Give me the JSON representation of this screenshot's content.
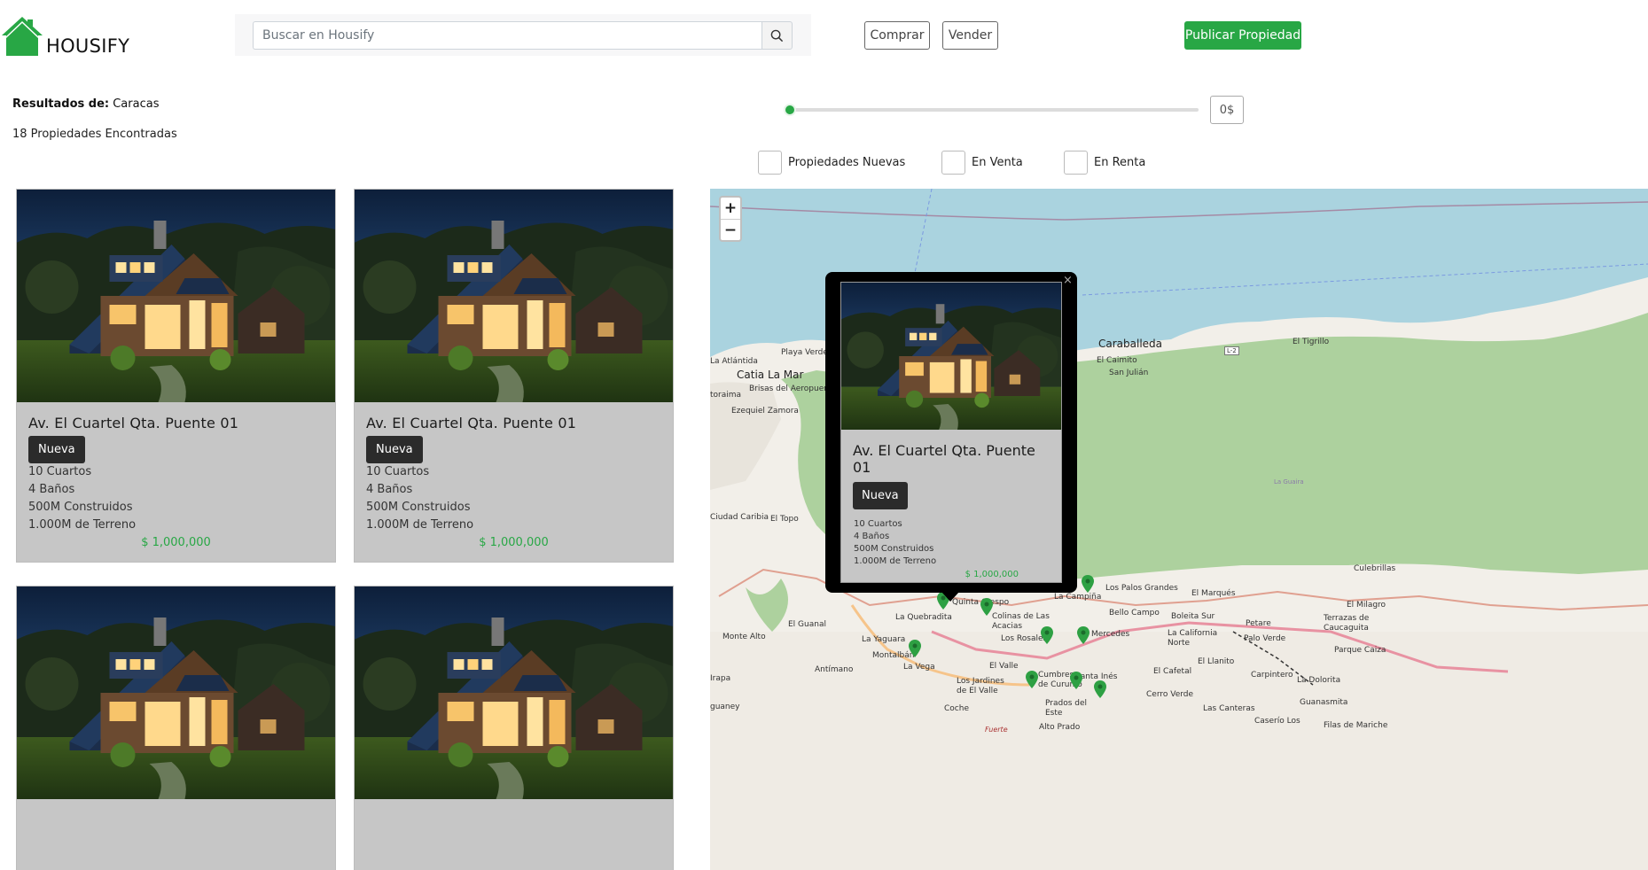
{
  "header": {
    "brand": "HOUSIFY",
    "search_placeholder": "Buscar en Housify",
    "buy_label": "Comprar",
    "sell_label": "Vender",
    "publish_label": "Publicar Propiedad"
  },
  "results": {
    "label": "Resultados de:",
    "location": "Caracas",
    "count_text": "18 Propiedades Encontradas"
  },
  "price_filter": {
    "value": "0$",
    "slider_fraction": 0
  },
  "filters": [
    {
      "label": "Propiedades Nuevas",
      "checked": false
    },
    {
      "label": "En Venta",
      "checked": false
    },
    {
      "label": "En Renta",
      "checked": false
    }
  ],
  "listings": [
    {
      "title": "Av. El Cuartel Qta. Puente 01",
      "badge": "Nueva",
      "rooms": "10 Cuartos",
      "baths": "4 Baños",
      "built": "500M Construidos",
      "land": "1.000M de Terreno",
      "price": "$ 1,000,000"
    },
    {
      "title": "Av. El Cuartel Qta. Puente 01",
      "badge": "Nueva",
      "rooms": "10 Cuartos",
      "baths": "4 Baños",
      "built": "500M Construidos",
      "land": "1.000M de Terreno",
      "price": "$ 1,000,000"
    },
    {
      "title": "",
      "badge": "",
      "rooms": "",
      "baths": "",
      "built": "",
      "land": "",
      "price": ""
    },
    {
      "title": "",
      "badge": "",
      "rooms": "",
      "baths": "",
      "built": "",
      "land": "",
      "price": ""
    }
  ],
  "map": {
    "zoom_in": "+",
    "zoom_out": "−",
    "labels": {
      "caraballeda": "Caraballeda",
      "catia": "Catia La Mar",
      "la_atlantida": "La Atlántida",
      "playa_verde": "Playa Verde",
      "el_caimito": "El Caimito",
      "san_julian": "San Julián",
      "el_tigrillo": "El Tigrillo",
      "brisas": "Brisas del Aeropuerto",
      "toraima": "toraima",
      "ezequiel": "Ezequiel Zamora",
      "ciudad_caribia": "Ciudad Caribia",
      "el_topo": "El Topo",
      "el_guanal": "El Guanal",
      "monte_alto": "Monte Alto",
      "la_yaguara": "La Yaguara",
      "montalban": "Montalbán",
      "antimano": "Antímano",
      "la_vega": "La Vega",
      "el_valle": "El Valle",
      "la_quebradita": "La Quebradita",
      "quinta_crespo": "Quinta Crespo",
      "colinas": "Colinas de Las Acacias",
      "los_rosales": "Los Rosales",
      "la_campina": "La Campiña",
      "bello_campo": "Bello Campo",
      "mercedes": "Mercedes",
      "los_palos_grandes": "Los Palos Grandes",
      "el_marques": "El Marqués",
      "boleita": "Boleita Sur",
      "la_california": "La California Norte",
      "petare": "Petare",
      "palo_verde": "Palo Verde",
      "el_llanito": "El Llanito",
      "carpintero": "Carpintero",
      "la_dolorita": "La Dolorita",
      "guanasmita": "Guanasmita",
      "las_canteras": "Las Canteras",
      "caserio": "Caserío Los",
      "filas": "Filas de Mariche",
      "el_cafetal": "El Cafetal",
      "cerro_verde": "Cerro Verde",
      "santa_ines": "Santa Inés",
      "cumbres": "Cumbres de Curumo",
      "prados": "Prados del Este",
      "los_jardines": "Los Jardines de El Valle",
      "coche": "Coche",
      "alto_prado": "Alto Prado",
      "fuerte": "Fuerte",
      "irapa": "Irapa",
      "guaney": "guaney",
      "culebrillas": "Culebrillas",
      "el_milagro": "El Milagro",
      "terrazas": "Terrazas de Caucaguita",
      "parque_caiza": "Parque Caiza",
      "la_guaira": "La Guaira",
      "l2": "L-2"
    }
  },
  "popup": {
    "close": "×",
    "title": "Av. El Cuartel Qta. Puente 01",
    "badge": "Nueva",
    "rooms": "10 Cuartos",
    "baths": "4 Baños",
    "built": "500M Construidos",
    "land": "1.000M de Terreno",
    "price": "$ 1,000,000"
  },
  "colors": {
    "accent": "#28a745",
    "card_bg": "#c6c6c6",
    "badge_bg": "#2b2b2b",
    "sea": "#aad3df",
    "land": "#f2efe9",
    "park": "#add19e"
  }
}
